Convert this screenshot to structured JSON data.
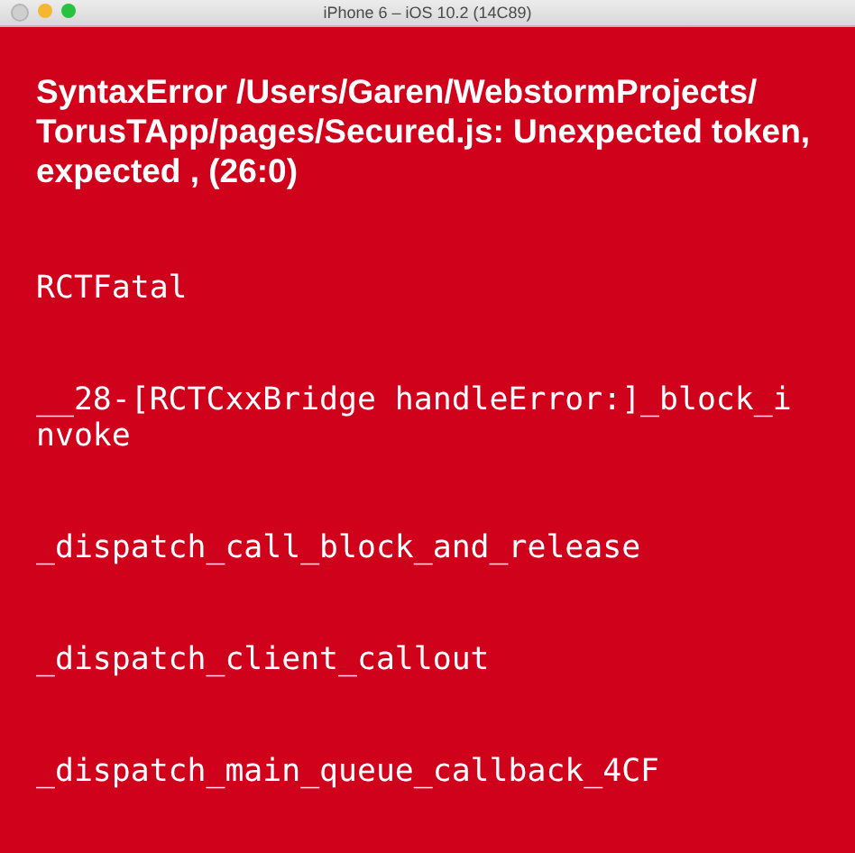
{
  "window": {
    "title": "iPhone 6 – iOS 10.2 (14C89)"
  },
  "error": {
    "message": "SyntaxError /Users/Garen/WebstormProjects/TorusTApp/pages/Secured.js: Unexpected token, expected , (26:0)",
    "stack": [
      "RCTFatal",
      "__28-[RCTCxxBridge handleError:]_block_invoke",
      "_dispatch_call_block_and_release",
      "_dispatch_client_callout",
      "_dispatch_main_queue_callback_4CF"
    ]
  }
}
